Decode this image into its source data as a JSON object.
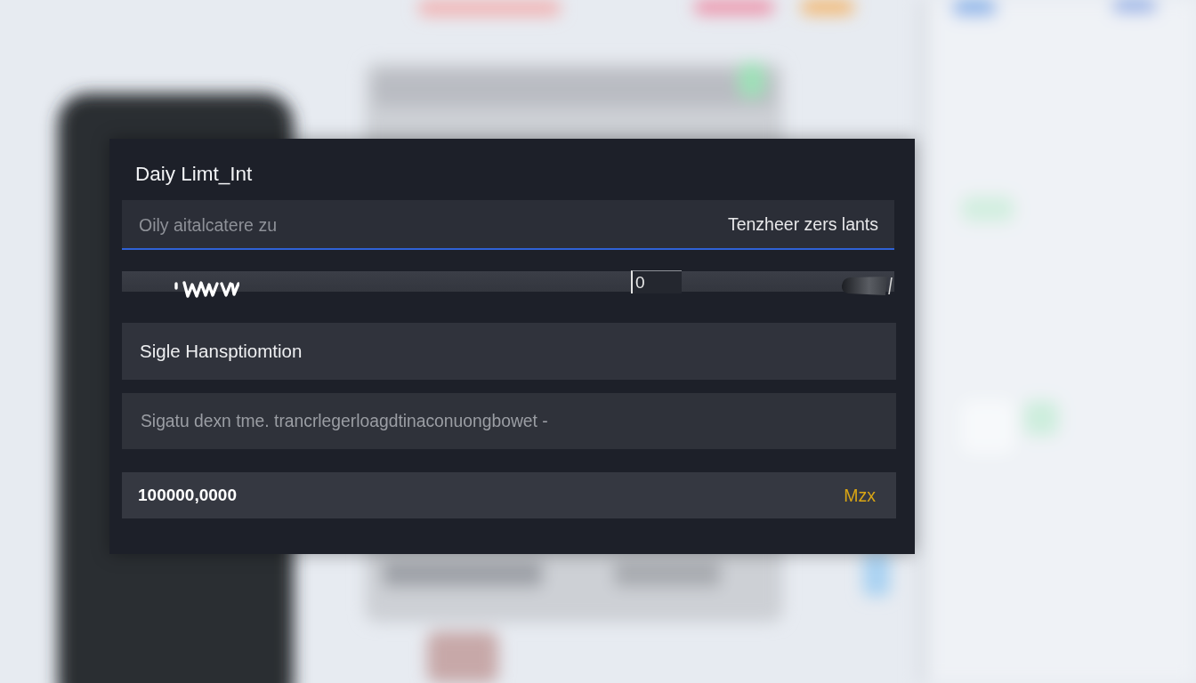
{
  "panel": {
    "title": "Daiy Limt_Int"
  },
  "limit_field": {
    "placeholder": "Oily aitalcatere zu",
    "hint": "Tenzheer zers lants",
    "focused": true
  },
  "slider": {
    "value": "0",
    "level": 0.965
  },
  "single_field": {
    "value": "Sigle Hansptiomtion"
  },
  "description_field": {
    "placeholder": "Sigatu dexn tme. trancrlegerloagdtinaconuongbowet -"
  },
  "amount_field": {
    "value": "100000,0000",
    "unit": "Mzx"
  }
}
